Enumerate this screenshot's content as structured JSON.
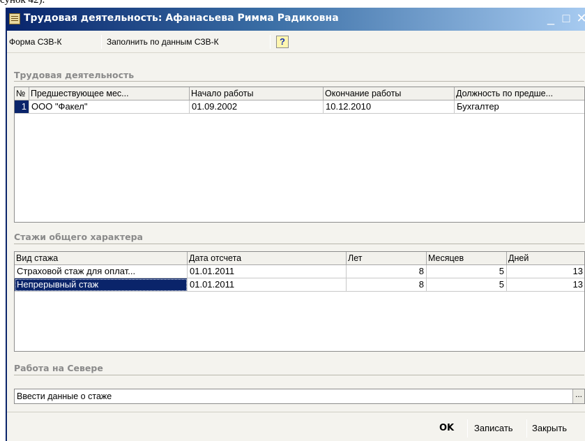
{
  "doc_snippet": "сунок 42).",
  "window": {
    "title": "Трудовая деятельность: Афанасьева Римма Радиковна",
    "minimize": "_",
    "maximize": "□",
    "close": "✕"
  },
  "toolbar": {
    "form_szv_k": "Форма СЗВ-К",
    "fill_from_szv_k": "Заполнить по данным СЗВ-К",
    "help": "?"
  },
  "work_activity": {
    "section_title": "Трудовая деятельность",
    "columns": [
      "№",
      "Предшествующее мес...",
      "Начало работы",
      "Окончание работы",
      "Должность по предше..."
    ],
    "rows": [
      [
        "1",
        "ООО \"Факел\"",
        "01.09.2002",
        "10.12.2010",
        "Бухгалтер"
      ]
    ]
  },
  "general_experience": {
    "section_title": "Стажи общего характера",
    "columns": [
      "Вид стажа",
      "Дата отсчета",
      "Лет",
      "Месяцев",
      "Дней"
    ],
    "rows": [
      [
        "Страховой стаж для оплат...",
        "01.01.2011",
        "8",
        "5",
        "13"
      ],
      [
        "Непрерывный стаж",
        "01.01.2011",
        "8",
        "5",
        "13"
      ]
    ]
  },
  "north_work": {
    "section_title": "Работа на Севере",
    "field_value": "Ввести данные о стаже",
    "button": "..."
  },
  "footer": {
    "ok": "OK",
    "save": "Записать",
    "close": "Закрыть"
  }
}
